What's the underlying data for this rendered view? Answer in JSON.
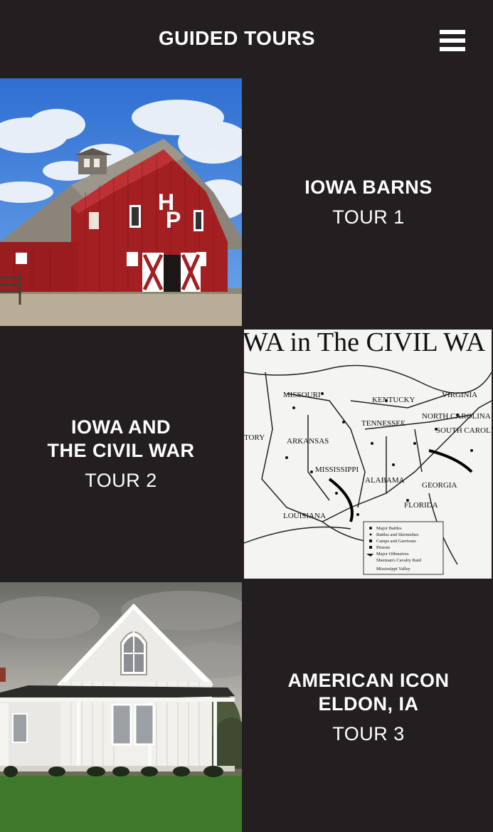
{
  "header": {
    "title": "GUIDED TOURS",
    "menu_icon": "hamburger-menu-icon"
  },
  "tours": [
    {
      "title": "IOWA BARNS",
      "subtitle": "TOUR 1",
      "image": "red-barn-photo"
    },
    {
      "title": "IOWA AND\nTHE CIVIL WAR",
      "subtitle": "TOUR 2",
      "image": "civil-war-map"
    },
    {
      "title": "AMERICAN ICON\nELDON, IA",
      "subtitle": "TOUR 3",
      "image": "white-gothic-house-photo"
    }
  ],
  "map_labels": {
    "heading": "WA in The CIVIL WA",
    "states": [
      "MISSOURI",
      "KENTUCKY",
      "VIRGINIA",
      "NORTH CAROLINA",
      "TENNESSEE",
      "ARKANSAS",
      "MISSISSIPPI",
      "ALABAMA",
      "GEORGIA",
      "SOUTH CAROLINA",
      "LOUISIANA",
      "FLORIDA",
      "TORY"
    ],
    "legend": [
      "Major Battles",
      "Battles and Skirmishes",
      "Camps and Garrisons",
      "Prisons",
      "Major Offensives",
      "Sherman's Cavalry Raid",
      "Mississippi Valley"
    ]
  }
}
